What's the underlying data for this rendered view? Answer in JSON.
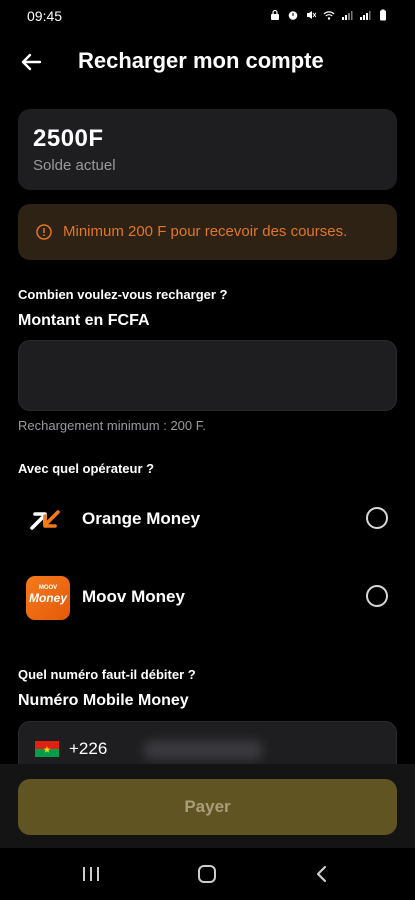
{
  "status_bar": {
    "time": "09:45",
    "icons": [
      "lock-icon",
      "alarm-icon",
      "mute-icon",
      "wifi-icon",
      "signal-icon",
      "signal-icon",
      "battery-icon"
    ]
  },
  "header": {
    "title": "Recharger mon compte",
    "back_icon": "arrow-left-icon"
  },
  "balance": {
    "amount": "2500F",
    "label": "Solde actuel"
  },
  "alert": {
    "icon": "info-icon",
    "text": "Minimum 200 F pour recevoir des courses.",
    "color": "#e07628"
  },
  "amount_section": {
    "question": "Combien voulez-vous recharger ?",
    "label": "Montant en FCFA",
    "value": "",
    "hint": "Rechargement minimum : 200 F."
  },
  "operator_section": {
    "question": "Avec quel opérateur ?",
    "operators": [
      {
        "name": "Orange Money",
        "logo": "orange-money-logo",
        "selected": false
      },
      {
        "name": "Moov Money",
        "logo": "moov-money-logo",
        "logo_text_top": "MOOV",
        "logo_text": "Money",
        "selected": false
      }
    ]
  },
  "phone_section": {
    "question": "Quel numéro faut-il débiter ?",
    "label": "Numéro Mobile Money",
    "prefix": "+226",
    "flag": "burkina-faso-flag"
  },
  "pay_button": {
    "label": "Payer",
    "color": "#5f5422"
  },
  "nav_bar": {
    "icons": [
      "recent-apps-icon",
      "home-icon",
      "back-icon"
    ]
  }
}
